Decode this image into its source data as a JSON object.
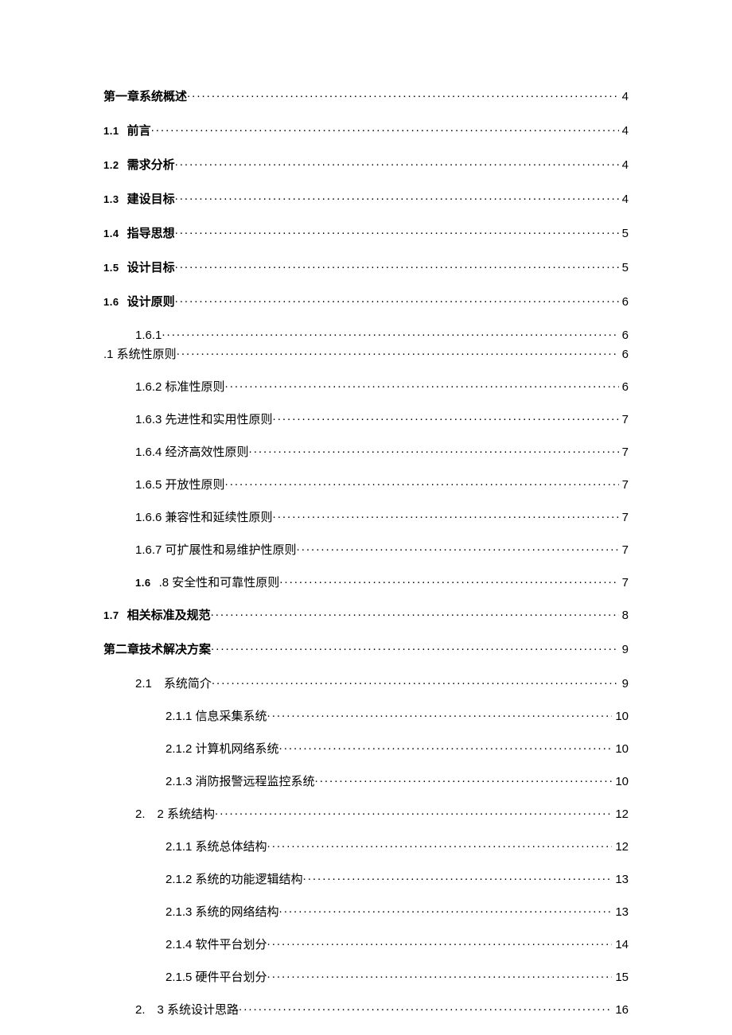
{
  "toc": [
    {
      "type": "l0",
      "num": "",
      "label": "第一章系统概述",
      "page": "4"
    },
    {
      "type": "l1",
      "num": "1.1",
      "label": "前言",
      "page": "4"
    },
    {
      "type": "l1",
      "num": "1.2",
      "label": "需求分析",
      "page": "4"
    },
    {
      "type": "l1",
      "num": "1.3",
      "label": "建设目标",
      "page": "4"
    },
    {
      "type": "l1",
      "num": "1.4",
      "label": "指导思想",
      "page": "5"
    },
    {
      "type": "l1",
      "num": "1.5",
      "label": "设计目标",
      "page": "5"
    },
    {
      "type": "l1",
      "num": "1.6",
      "label": "设计原则",
      "page": "6"
    },
    {
      "type": "multi161",
      "line1_label": "1.6.1",
      "line1_page": "6",
      "line2_label": ".1 系统性原则",
      "line2_page": "6"
    },
    {
      "type": "l2",
      "num": "",
      "label": "1.6.2 标准性原则",
      "page": "6"
    },
    {
      "type": "l2",
      "num": "",
      "label": "1.6.3 先进性和实用性原则",
      "page": "7"
    },
    {
      "type": "l2",
      "num": "",
      "label": "1.6.4 经济高效性原则",
      "page": "7"
    },
    {
      "type": "l2",
      "num": "",
      "label": "1.6.5 开放性原则",
      "page": "7"
    },
    {
      "type": "l2",
      "num": "",
      "label": "1.6.6 兼容性和延续性原则",
      "page": "7"
    },
    {
      "type": "l2",
      "num": "",
      "label": "1.6.7 可扩展性和易维护性原则",
      "page": "7"
    },
    {
      "type": "l2b",
      "num": "1.6",
      "label": ".8 安全性和可靠性原则",
      "page": "7"
    },
    {
      "type": "l1",
      "num": "1.7",
      "label": "相关标准及规范",
      "page": "8"
    },
    {
      "type": "l0",
      "num": "",
      "label": "第二章技术解决方案",
      "page": "9"
    },
    {
      "type": "l2",
      "num": "",
      "label": "2.1　系统简介",
      "page": "9"
    },
    {
      "type": "l3",
      "num": "",
      "label": "2.1.1 信息采集系统",
      "page": "10"
    },
    {
      "type": "l3",
      "num": "",
      "label": "2.1.2 计算机网络系统",
      "page": "10"
    },
    {
      "type": "l3",
      "num": "",
      "label": "2.1.3 消防报警远程监控系统",
      "page": "10"
    },
    {
      "type": "l2",
      "num": "",
      "label": "2.　2 系统结构",
      "page": "12"
    },
    {
      "type": "l3",
      "num": "",
      "label": "2.1.1 系统总体结构",
      "page": "12"
    },
    {
      "type": "l3",
      "num": "",
      "label": "2.1.2 系统的功能逻辑结构",
      "page": "13"
    },
    {
      "type": "l3",
      "num": "",
      "label": "2.1.3 系统的网络结构",
      "page": "13"
    },
    {
      "type": "l3",
      "num": "",
      "label": "2.1.4 软件平台划分",
      "page": "14"
    },
    {
      "type": "l3",
      "num": "",
      "label": "2.1.5 硬件平台划分",
      "page": "15"
    },
    {
      "type": "l2",
      "num": "",
      "label": "2.　3 系统设计思路",
      "page": "16"
    }
  ]
}
